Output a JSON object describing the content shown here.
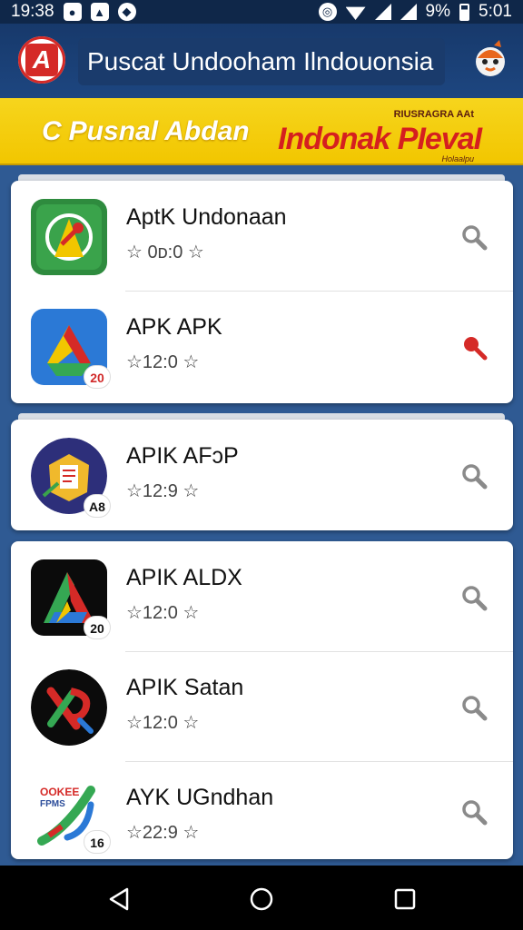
{
  "status_bar": {
    "time": "19:38",
    "battery_text": "9%",
    "clock_right": "5:01"
  },
  "app_bar": {
    "title": "Puscat Undooham Ilndouonsia",
    "logo_letter": "A"
  },
  "banner": {
    "left_text": "Pusnal Abdan",
    "brand_top": "RIUSRAGRA AAt",
    "brand_main": "Indonak PIevaI",
    "brand_sub": "Holaalpu"
  },
  "groups": [
    {
      "items": [
        {
          "name": "AptK Undonaan",
          "rating": "☆ 0ᴅ:0 ☆",
          "icon": "green-compass-icon",
          "badge": "",
          "search_active": false
        },
        {
          "name": "APK APK",
          "rating": "☆12:0 ☆",
          "icon": "drive-triangle-icon",
          "badge": "20",
          "search_active": true
        }
      ]
    },
    {
      "items": [
        {
          "name": "APIK AFɔP",
          "rating": "☆12:9 ☆",
          "icon": "emblem-book-icon",
          "badge": "A8",
          "search_active": false
        }
      ]
    },
    {
      "items": [
        {
          "name": "APIK ALDX",
          "rating": "☆12:0 ☆",
          "icon": "colorful-a-icon",
          "badge": "20",
          "search_active": false
        },
        {
          "name": "APIK Satan",
          "rating": "☆12:0 ☆",
          "icon": "rk-logo-icon",
          "badge": "",
          "search_active": false
        },
        {
          "name": "AYK UGndhan",
          "rating": "☆22:9 ☆",
          "icon": "sticker-swoosh-icon",
          "badge": "16",
          "search_active": false
        }
      ]
    }
  ],
  "icon_labels": {
    "sticker_top": "OOKEE",
    "sticker_mid": "FPMS"
  },
  "colors": {
    "appbar": "#17396b",
    "banner": "#f2c600",
    "accent_red": "#d52a27",
    "search_gray": "#8a8a8a"
  }
}
